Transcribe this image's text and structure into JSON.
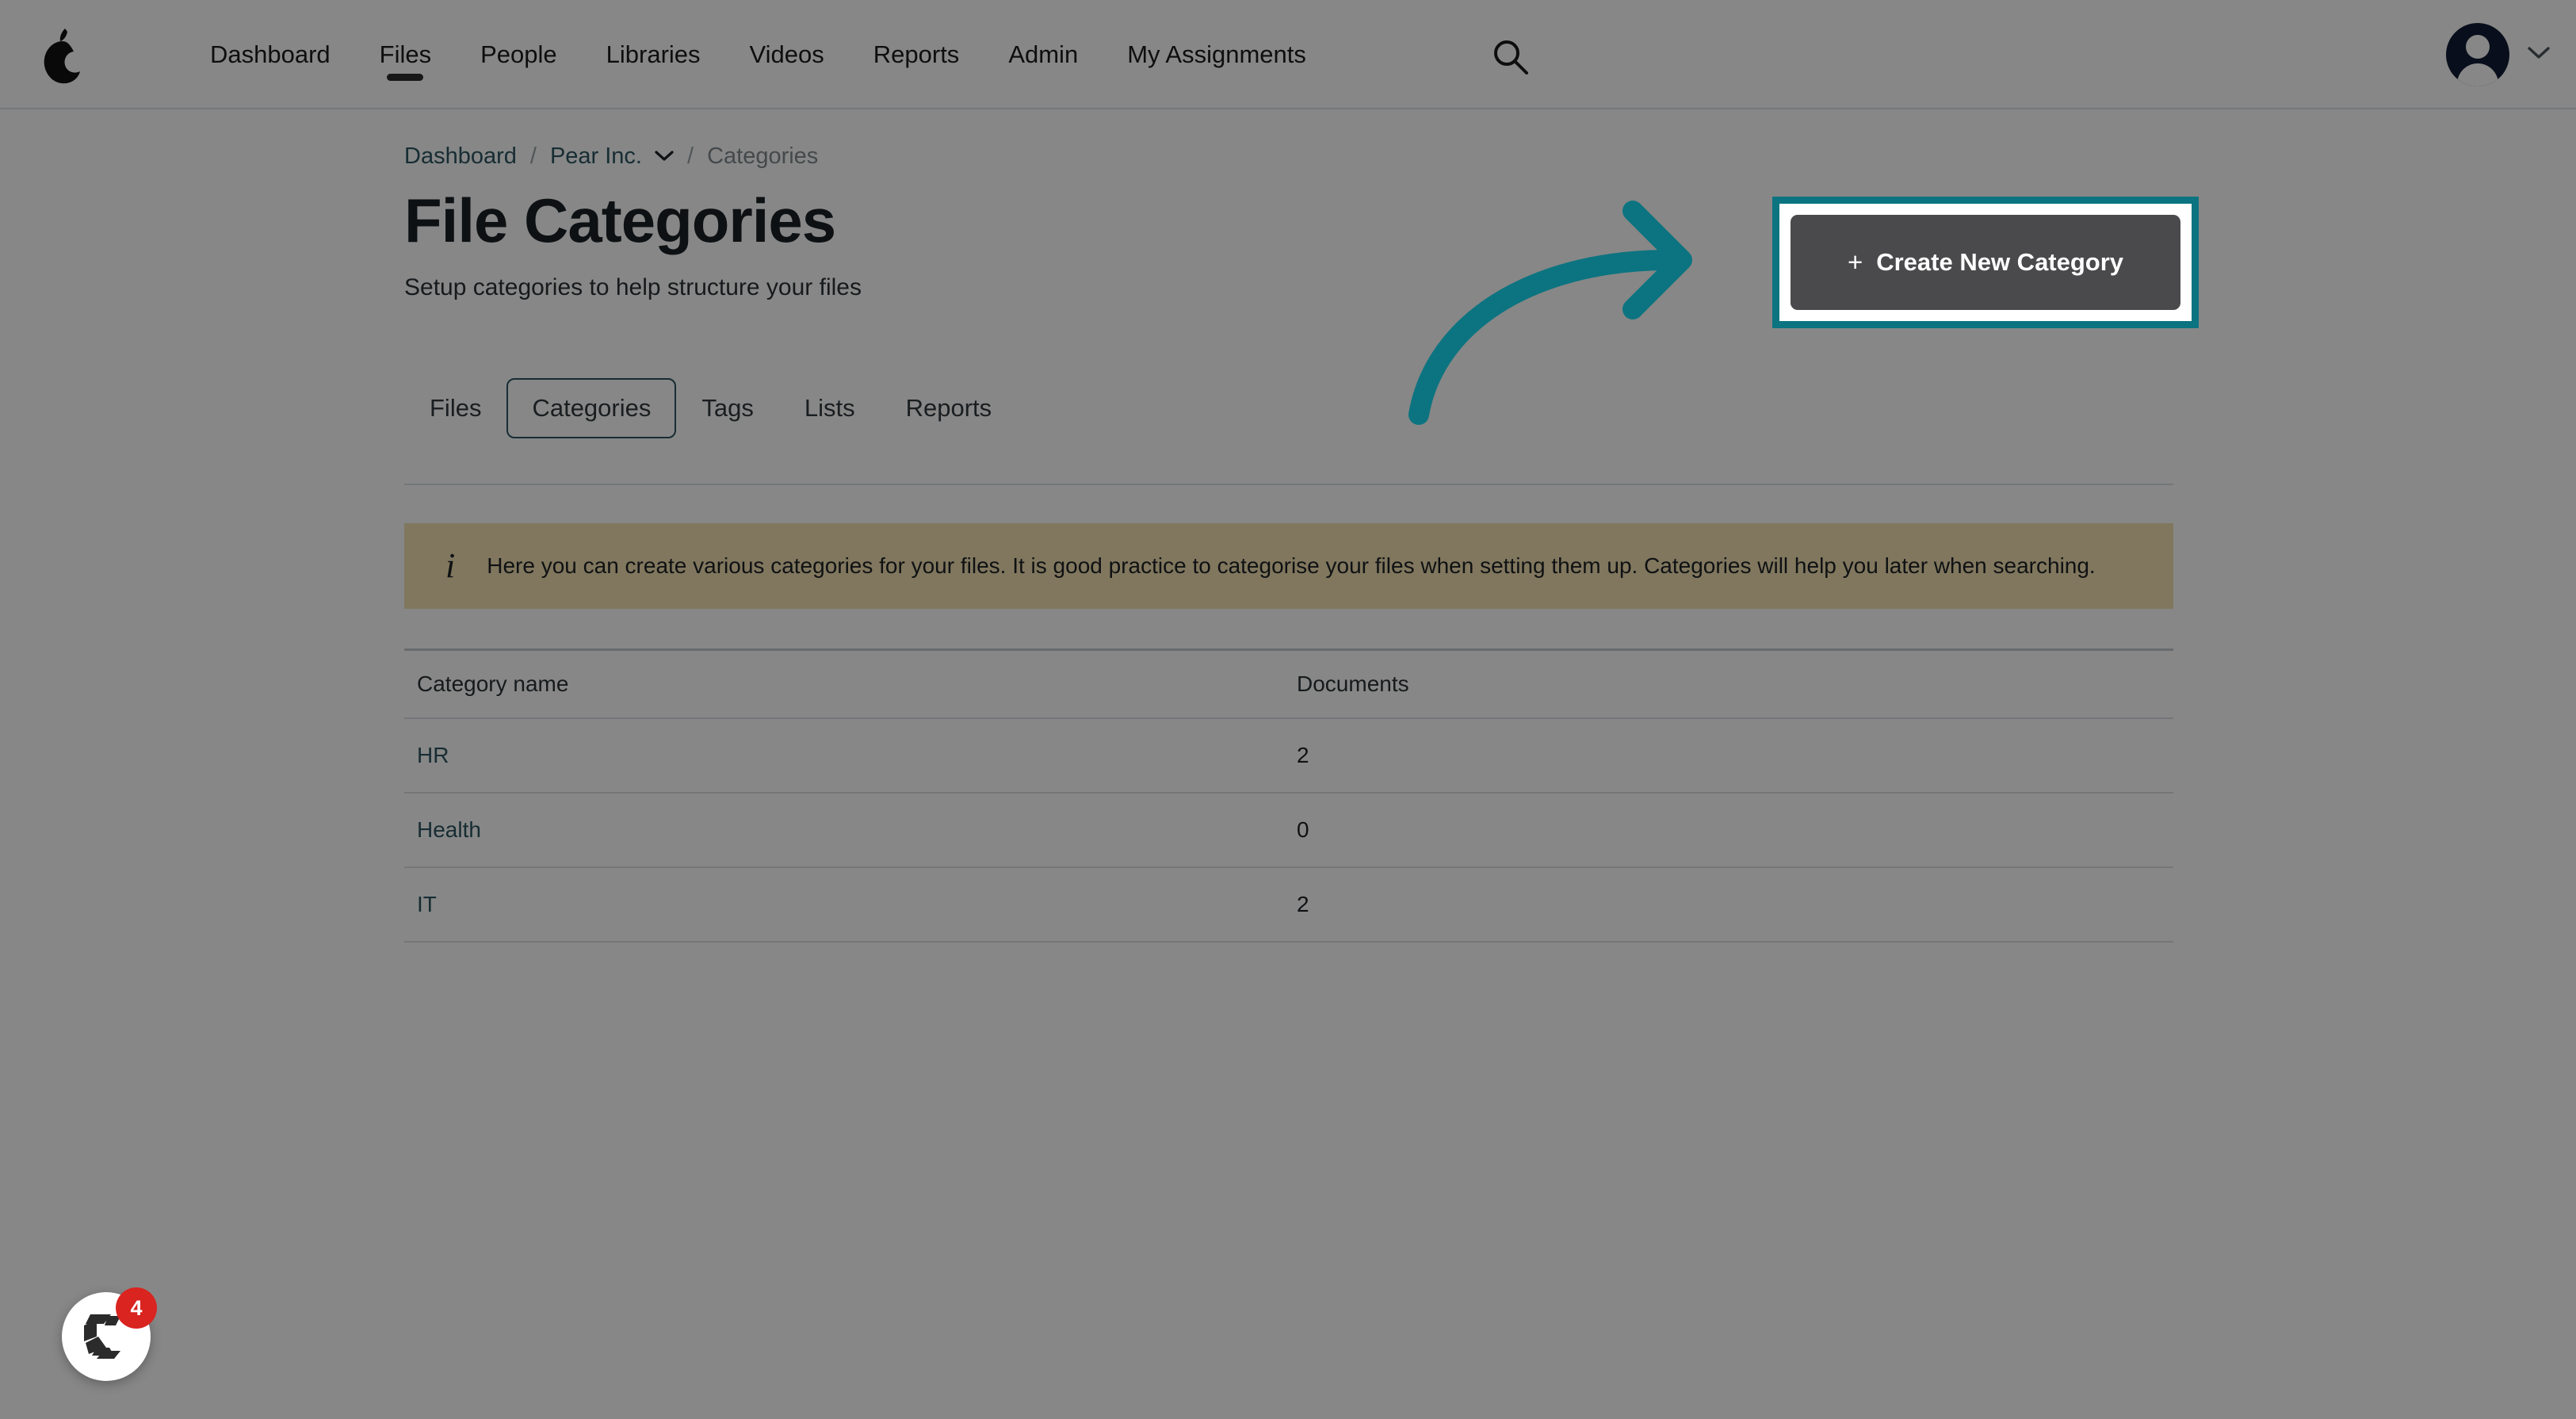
{
  "navbar": {
    "logo_icon": "pear-logo-icon",
    "links": [
      {
        "label": "Dashboard",
        "active": false
      },
      {
        "label": "Files",
        "active": true
      },
      {
        "label": "People",
        "active": false
      },
      {
        "label": "Libraries",
        "active": false
      },
      {
        "label": "Videos",
        "active": false
      },
      {
        "label": "Reports",
        "active": false
      },
      {
        "label": "Admin",
        "active": false
      },
      {
        "label": "My Assignments",
        "active": false
      }
    ],
    "search_icon": "search-icon",
    "avatar_icon": "user-avatar-icon",
    "avatar_chevron_icon": "chevron-down-icon"
  },
  "breadcrumb": {
    "dashboard": "Dashboard",
    "separator": "/",
    "org": "Pear Inc.",
    "org_chevron_icon": "chevron-down-icon",
    "current": "Categories"
  },
  "header": {
    "title": "File Categories",
    "subtitle": "Setup categories to help structure your files"
  },
  "create_button": {
    "plus": "+",
    "label": "Create New Category",
    "highlight_color": "#0c7480",
    "button_color": "#4a4a4c"
  },
  "annotation": {
    "arrow_icon": "curved-arrow-right-icon",
    "arrow_color": "#0c7480"
  },
  "tabs": [
    {
      "label": "Files",
      "active": false
    },
    {
      "label": "Categories",
      "active": true
    },
    {
      "label": "Tags",
      "active": false
    },
    {
      "label": "Lists",
      "active": false
    },
    {
      "label": "Reports",
      "active": false
    }
  ],
  "info_banner": {
    "icon": "info-italic-i-icon",
    "text": "Here you can create various categories for your files. It is good practice to categorise your files when setting them up. Categories will help you later when searching.",
    "background_color": "#f2e0b2"
  },
  "table": {
    "columns": [
      "Category name",
      "Documents"
    ],
    "rows": [
      {
        "name": "HR",
        "documents": "2"
      },
      {
        "name": "Health",
        "documents": "0"
      },
      {
        "name": "IT",
        "documents": "2"
      }
    ]
  },
  "help_widget": {
    "icon": "chameleon-help-icon",
    "badge_count": "4",
    "badge_color": "#d9241f"
  }
}
